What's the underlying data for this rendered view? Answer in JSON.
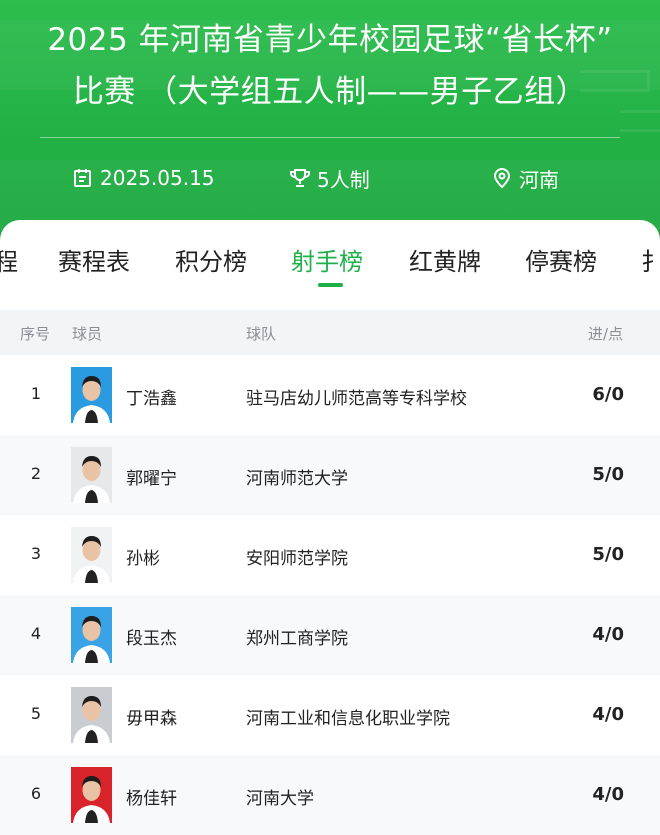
{
  "header": {
    "title_line1": "2025 年河南省青少年校园足球“省长杯”",
    "title_line2": "比赛 （大学组五人制——男子乙组）",
    "date": "2025.05.15",
    "format": "5人制",
    "location": "河南"
  },
  "tabs": [
    {
      "label": "程"
    },
    {
      "label": "赛程表"
    },
    {
      "label": "积分榜"
    },
    {
      "label": "射手榜",
      "active": true
    },
    {
      "label": "红黄牌"
    },
    {
      "label": "停赛榜"
    },
    {
      "label": "扌"
    }
  ],
  "table": {
    "headers": {
      "rank": "序号",
      "player": "球员",
      "team": "球队",
      "stat": "进/点"
    },
    "rows": [
      {
        "rank": "1",
        "name": "丁浩鑫",
        "team": "驻马店幼儿师范高等专科学校",
        "stat": "6/0",
        "photo_bg": "#2a9be0"
      },
      {
        "rank": "2",
        "name": "郭曜宁",
        "team": "河南师范大学",
        "stat": "5/0",
        "photo_bg": "#e6e8ea"
      },
      {
        "rank": "3",
        "name": "孙彬",
        "team": "安阳师范学院",
        "stat": "5/0",
        "photo_bg": "#f1f2f4"
      },
      {
        "rank": "4",
        "name": "段玉杰",
        "team": "郑州工商学院",
        "stat": "4/0",
        "photo_bg": "#3aa3e6"
      },
      {
        "rank": "5",
        "name": "毋甲森",
        "team": "河南工业和信息化职业学院",
        "stat": "4/0",
        "photo_bg": "#c9cdd2"
      },
      {
        "rank": "6",
        "name": "杨佳轩",
        "team": "河南大学",
        "stat": "4/0",
        "photo_bg": "#d8232a"
      }
    ]
  },
  "colors": {
    "brand_green": "#22b045",
    "active_tab": "#1fb04a"
  }
}
